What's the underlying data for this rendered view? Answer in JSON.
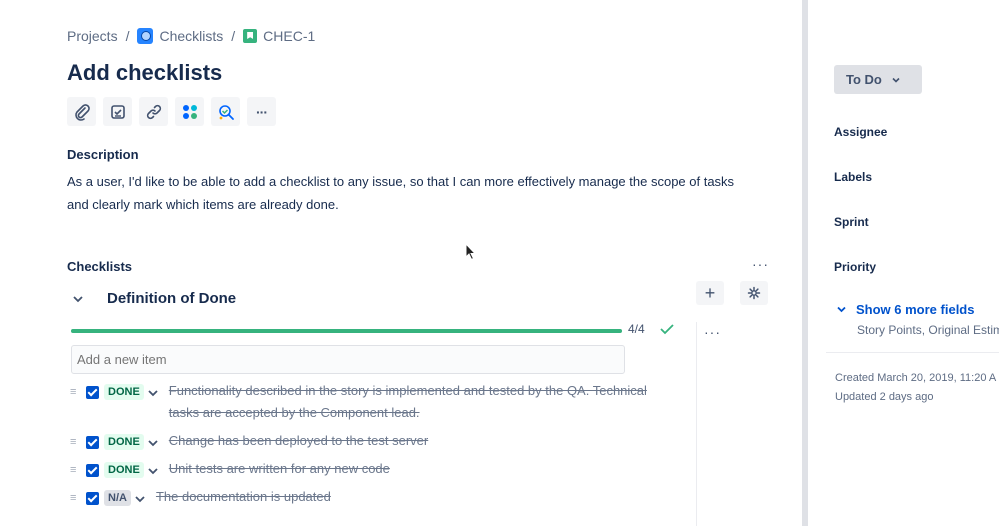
{
  "breadcrumb": {
    "root": "Projects",
    "separator": "/",
    "project": "Checklists",
    "issue_key": "CHEC-1"
  },
  "issue": {
    "title": "Add checklists",
    "description_label": "Description",
    "description": "As a user, I'd like to be able to add a checklist to any issue, so that I can more effectively manage the scope of tasks and clearly mark which items are already done."
  },
  "toolbar": {
    "icons": [
      "attach-icon",
      "subtask-icon",
      "link-issue-icon",
      "apps-icon",
      "checklist-app-icon",
      "more-icon"
    ],
    "more_label": "···"
  },
  "checklists": {
    "label": "Checklists",
    "more_label": "···",
    "definition": {
      "title": "Definition of Done",
      "add_label": "+",
      "progress_text": "4/4",
      "progress_fraction": 1.0,
      "item_menu_label": "···",
      "add_placeholder": "Add a new item",
      "items": [
        {
          "status": "DONE",
          "text": "Functionality described in the story is implemented and tested by the QA. Technical tasks are accepted by the Component lead.",
          "checked": true
        },
        {
          "status": "DONE",
          "text": "Change has been deployed to the test server",
          "checked": true
        },
        {
          "status": "DONE",
          "text": "Unit tests are written for any new code",
          "checked": true
        },
        {
          "status": "N/A",
          "text": "The documentation is updated",
          "checked": true
        }
      ]
    }
  },
  "sidebar": {
    "status_label": "To Do",
    "fields": [
      "Assignee",
      "Labels",
      "Sprint",
      "Priority"
    ],
    "show_more_label": "Show 6 more fields",
    "show_more_sub": "Story Points, Original Estima",
    "created": "Created March 20, 2019, 11:20 A",
    "updated": "Updated 2 days ago"
  },
  "colors": {
    "accent": "#0052cc",
    "progress": "#36b37e",
    "done_badge_bg": "#e3fcef",
    "done_badge_text": "#006644"
  }
}
